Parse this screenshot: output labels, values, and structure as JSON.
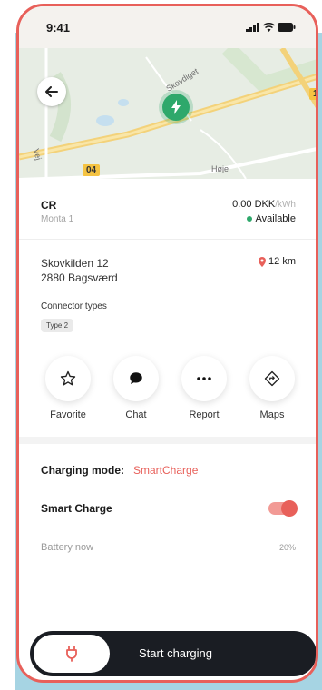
{
  "status_bar": {
    "time": "9:41"
  },
  "map": {
    "road_label_1": "Skovdiget",
    "road_label_2": "Vej",
    "road_label_3": "Høje",
    "road_sign_1": "04",
    "road_sign_2": "1"
  },
  "station": {
    "name": "CR",
    "operator": "Monta 1",
    "price": "0.00 DKK",
    "price_unit": "/kWh",
    "availability": "Available",
    "address_line1": "Skovkilden 12",
    "address_line2": "2880 Bagsværd",
    "distance": "12 km"
  },
  "connectors": {
    "title": "Connector types",
    "items": [
      "Type 2"
    ]
  },
  "actions": {
    "favorite": "Favorite",
    "chat": "Chat",
    "report": "Report",
    "maps": "Maps"
  },
  "charging": {
    "mode_label": "Charging mode:",
    "mode_value": "SmartCharge",
    "smart_charge_label": "Smart Charge",
    "smart_charge_on": true,
    "battery_label": "Battery now",
    "battery_value": "20%"
  },
  "start_button": {
    "label": "Start charging"
  },
  "colors": {
    "accent": "#e8605a",
    "available": "#2ea86b",
    "dark": "#1a1d23",
    "backdrop": "#a6d4e3"
  }
}
